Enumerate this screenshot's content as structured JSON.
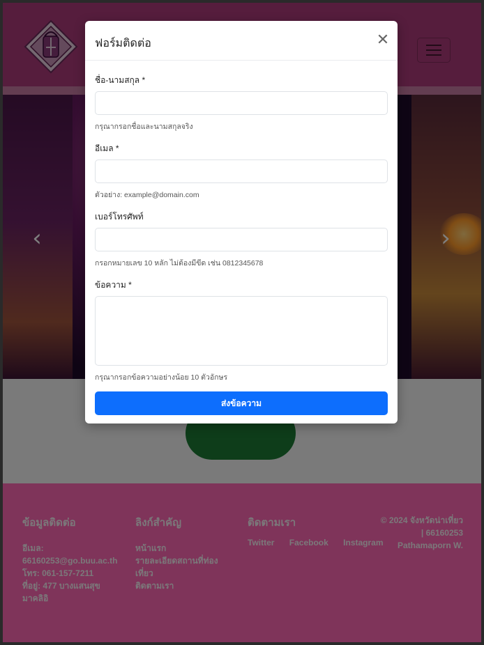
{
  "modal": {
    "title": "ฟอร์มติดต่อ",
    "close_icon": "close-icon",
    "fields": [
      {
        "label": "ชื่อ-นามสกุล *",
        "value": "",
        "placeholder": "",
        "help": "กรุณากรอกชื่อและนามสกุลจริง"
      },
      {
        "label": "อีเมล *",
        "value": "",
        "placeholder": "",
        "help": "ตัวอย่าง: example@domain.com"
      },
      {
        "label": "เบอร์โทรศัพท์",
        "value": "",
        "placeholder": "",
        "help": "กรอกหมายเลข 10 หลัก ไม่ต้องมีขีด เช่น 0812345678"
      },
      {
        "label": "ข้อความ *",
        "value": "",
        "placeholder": "",
        "help": "กรุณากรอกข้อความอย่างน้อย 10 ตัวอักษร"
      }
    ],
    "submit_label": "ส่งข้อความ",
    "submit_color": "#0d6efd"
  },
  "header": {
    "brand_color": "#ad3a7a",
    "logo_icon": "province-seal-icon",
    "toggler_icon": "hamburger-icon"
  },
  "carousel": {
    "prev_icon": "chevron-left-icon",
    "prev_glyph": "‹",
    "next_icon": "chevron-right-icon",
    "next_glyph": "›"
  },
  "footer": {
    "bg_color": "#ff69b4",
    "contact": {
      "heading": "ข้อมูลติดต่อ",
      "email_label": "อีเมล:",
      "email": "66160253@go.buu.ac.th",
      "phone": "โทร: 061-157-7211",
      "address_line1": "ที่อยู่: 477 บางแสนสุข",
      "address_line2": "มาคลิอิ"
    },
    "links": {
      "heading": "ลิงก์สำคัญ",
      "items": [
        "หน้าแรก",
        "รายละเอียดสถานที่ท่อง",
        "เที่ยว",
        "ติดตามเรา"
      ]
    },
    "follow": {
      "heading": "ติดตามเรา",
      "items": [
        "Twitter",
        "Facebook",
        "Instagram"
      ]
    },
    "copyright": {
      "line1": "© 2024 จังหวัดน่าเที่ยว",
      "line2": "| 66160253",
      "line3": "Pathamaporn W."
    }
  }
}
